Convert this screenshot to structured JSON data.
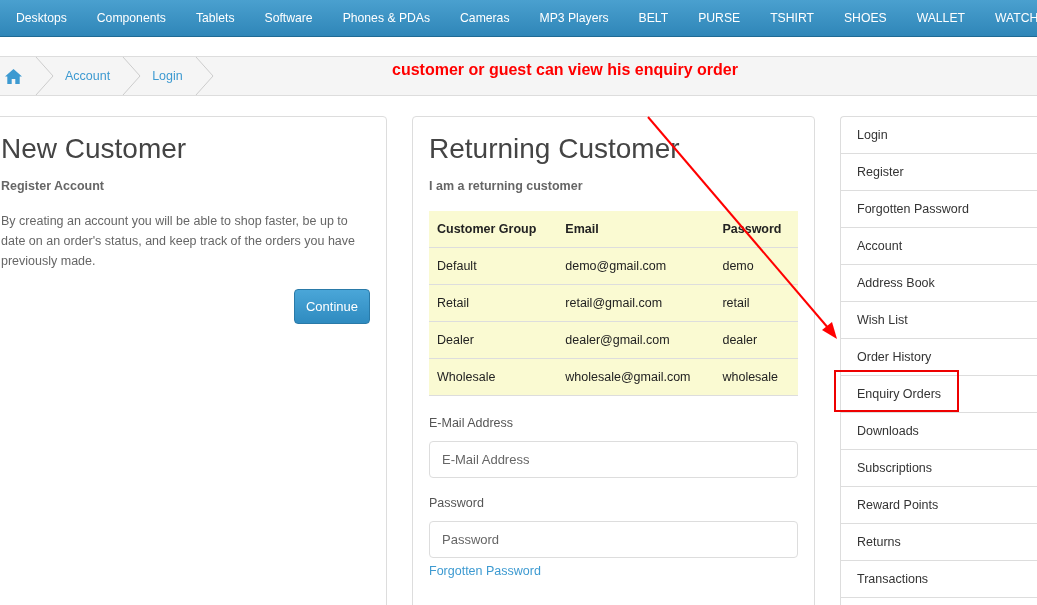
{
  "nav": [
    "Desktops",
    "Components",
    "Tablets",
    "Software",
    "Phones & PDAs",
    "Cameras",
    "MP3 Players",
    "BELT",
    "PURSE",
    "TSHIRT",
    "SHOES",
    "WALLET",
    "WATCH"
  ],
  "breadcrumb": [
    "Account",
    "Login"
  ],
  "annotation": {
    "text": "customer or guest can view his enquiry order"
  },
  "new_customer": {
    "title": "New Customer",
    "subtitle": "Register Account",
    "text": "By creating an account you will be able to shop faster, be up to date on an order's status, and keep track of the orders you have previously made.",
    "button": "Continue"
  },
  "returning_customer": {
    "title": "Returning Customer",
    "subtitle": "I am a returning customer",
    "table": {
      "columns": [
        "Customer Group",
        "Email",
        "Password"
      ],
      "rows": [
        [
          "Default",
          "demo@gmail.com",
          "demo"
        ],
        [
          "Retail",
          "retail@gmail.com",
          "retail"
        ],
        [
          "Dealer",
          "dealer@gmail.com",
          "dealer"
        ],
        [
          "Wholesale",
          "wholesale@gmail.com",
          "wholesale"
        ]
      ]
    },
    "email_label": "E-Mail Address",
    "email_placeholder": "E-Mail Address",
    "password_label": "Password",
    "password_placeholder": "Password",
    "forgotten_link": "Forgotten Password"
  },
  "sidebar": {
    "items": [
      {
        "label": "Login",
        "highlighted": false
      },
      {
        "label": "Register",
        "highlighted": false
      },
      {
        "label": "Forgotten Password",
        "highlighted": false
      },
      {
        "label": "Account",
        "highlighted": false
      },
      {
        "label": "Address Book",
        "highlighted": false
      },
      {
        "label": "Wish List",
        "highlighted": false
      },
      {
        "label": "Order History",
        "highlighted": false
      },
      {
        "label": "Enquiry Orders",
        "highlighted": true
      },
      {
        "label": "Downloads",
        "highlighted": false
      },
      {
        "label": "Subscriptions",
        "highlighted": false
      },
      {
        "label": "Reward Points",
        "highlighted": false
      },
      {
        "label": "Returns",
        "highlighted": false
      },
      {
        "label": "Transactions",
        "highlighted": false
      }
    ]
  }
}
